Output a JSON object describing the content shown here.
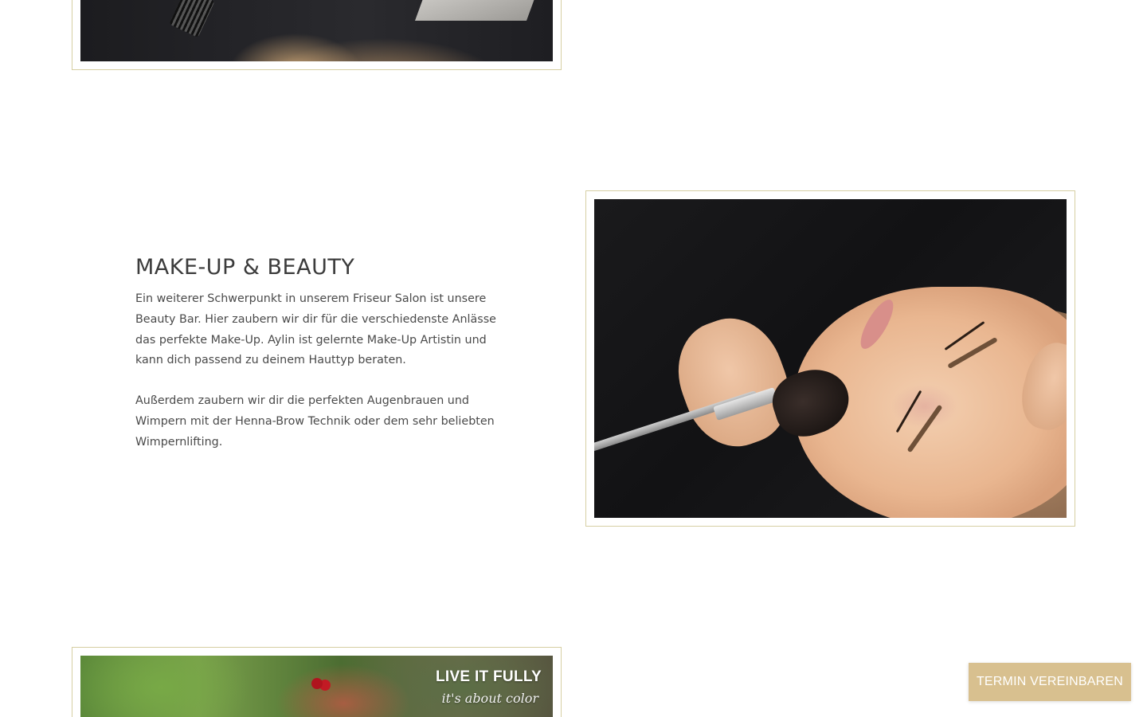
{
  "section": {
    "title": "MAKE-UP & BEAUTY",
    "paragraph_1": "Ein weiterer Schwerpunkt in unserem Friseur Salon ist unsere Beauty Bar. Hier zaubern wir dir für die verschiedenste Anlässe das perfekte Make-Up. Aylin ist gelernte Make-Up Artistin und kann dich passend zu deinem Hauttyp beraten.",
    "paragraph_2": "Außerdem zaubern wir dir die perfekten Augenbrauen und Wimpern mit der Henna-Brow Technik oder dem sehr beliebten Wimpernlifting."
  },
  "bottom_image": {
    "overlay_title": "LIVE IT FULLY",
    "overlay_script": "it's about color"
  },
  "cta": {
    "label": "TERMIN VEREINBAREN"
  },
  "colors": {
    "frame_border": "#d6cfa3",
    "cta_background": "#d8c08f",
    "cta_text": "#ffffff",
    "heading_text": "#3c3c3c",
    "body_text": "#4a4a4a"
  }
}
